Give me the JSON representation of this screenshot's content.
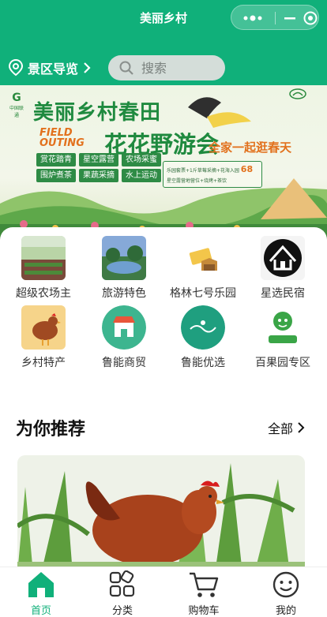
{
  "app": {
    "title": "美丽乡村",
    "accent": "#10b07a"
  },
  "header": {
    "location_label": "景区导览",
    "search_placeholder": "搜索"
  },
  "banner": {
    "logo_left": "中国联通",
    "title_line1": "美丽乡村春田",
    "title_line2": "花花野游会",
    "field_outing": "FIELD OUTING",
    "slogan": "全家一起逛春天",
    "tags": [
      "赏花踏青",
      "星空露营",
      "农场采蜜",
      "围炉煮茶",
      "果蔬采摘",
      "水上运动"
    ],
    "promo_line1": "乐园套票+1斤草莓采摘+花海入园",
    "promo_line2": "星空露营地营位+烧烤+茶饮",
    "promo_price": "68"
  },
  "categories": [
    {
      "label": "超级农场主",
      "icon": "farm-photo-icon"
    },
    {
      "label": "旅游特色",
      "icon": "lake-photo-icon"
    },
    {
      "label": "格林七号乐园",
      "icon": "ticket-icon"
    },
    {
      "label": "星选民宿",
      "icon": "house-icon"
    },
    {
      "label": "乡村特产",
      "icon": "chicken-icon"
    },
    {
      "label": "鲁能商贸",
      "icon": "store-icon"
    },
    {
      "label": "鲁能优选",
      "icon": "luneng-select-icon"
    },
    {
      "label": "百果园专区",
      "icon": "fruit-monkey-icon"
    }
  ],
  "recommend": {
    "title": "为你推荐",
    "all_label": "全部"
  },
  "tabs": [
    {
      "label": "首页",
      "icon": "home-icon",
      "active": true
    },
    {
      "label": "分类",
      "icon": "category-icon",
      "active": false
    },
    {
      "label": "购物车",
      "icon": "cart-icon",
      "active": false
    },
    {
      "label": "我的",
      "icon": "profile-icon",
      "active": false
    }
  ]
}
